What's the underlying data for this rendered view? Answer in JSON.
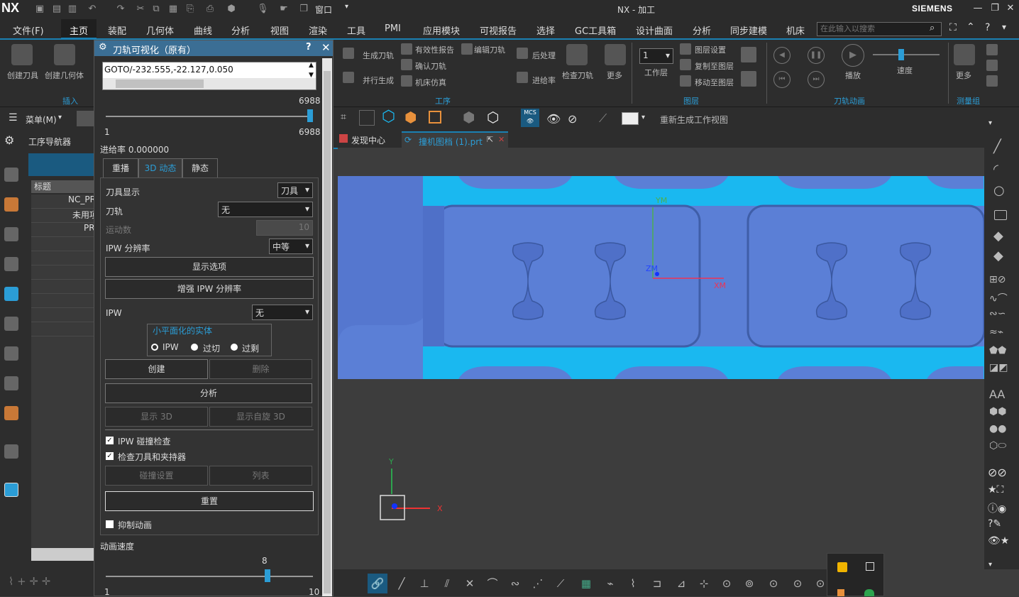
{
  "titlebar": {
    "logo": "NX",
    "window_menu": "窗口",
    "title": "NX - 加工",
    "brand": "SIEMENS"
  },
  "menubar": {
    "items": [
      "文件(F)",
      "主页",
      "装配",
      "几何体",
      "曲线",
      "分析",
      "视图",
      "渲染",
      "工具",
      "PMI",
      "应用模块",
      "可视报告",
      "选择",
      "GC工具箱",
      "设计曲面",
      "分析",
      "同步建模",
      "机床"
    ],
    "search_placeholder": "在此输入以搜索"
  },
  "ribbon": {
    "insert": {
      "create_tool": "创建刀具",
      "create_geometry": "创建几何体",
      "group": "插入"
    },
    "operation": {
      "gen_toolpath": "生成刀轨",
      "parallel_gen": "并行生成",
      "validity_report": "有效性报告",
      "confirm_toolpath": "确认刀轨",
      "machine_sim": "机床仿真",
      "edit_toolpath": "编辑刀轨",
      "postprocess": "后处理",
      "feedrate": "进给率",
      "check_toolpath": "检查刀轨",
      "more": "更多",
      "group": "工序"
    },
    "layer": {
      "work_layer_value": "1",
      "work_layer": "工作层",
      "layer_settings": "图层设置",
      "copy_to_layer": "复制至图层",
      "move_to_layer": "移动至图层",
      "group": "图层"
    },
    "animation": {
      "play": "播放",
      "speed": "速度",
      "group": "刀轨动画"
    },
    "measure": {
      "more": "更多",
      "group": "测量组"
    }
  },
  "toolbar2": {
    "menu": "菜单(M)",
    "regenerate": "重新生成工作视图",
    "mcs": "MCS"
  },
  "navigator": {
    "title": "工序导航器",
    "column": "标题",
    "rows": [
      "NC_PR",
      "未用项",
      "PR",
      "",
      "",
      "",
      "",
      "",
      "",
      ""
    ]
  },
  "dialog": {
    "title": "刀轨可视化（原有）",
    "goto_text": "GOTO/-232.555,-22.127,0.050",
    "slider_max_top": "6988",
    "slider_min": "1",
    "slider_max": "6988",
    "feedrate_label": "进给率",
    "feedrate_value": "0.000000",
    "tabs": [
      "重播",
      "3D 动态",
      "静态"
    ],
    "tool_display_label": "刀具显示",
    "tool_display_value": "刀具",
    "toolpath_label": "刀轨",
    "toolpath_value": "无",
    "motion_count_label": "运动数",
    "motion_count_value": "10",
    "ipw_res_label": "IPW 分辨率",
    "ipw_res_value": "中等",
    "display_options": "显示选项",
    "increase_ipw": "增强 IPW 分辨率",
    "ipw_label": "IPW",
    "ipw_value": "无",
    "faceted_group": "小平面化的实体",
    "radio_ipw": "IPW",
    "radio_overcut": "过切",
    "radio_excess": "过剩",
    "create": "创建",
    "delete": "删除",
    "analyze": "分析",
    "show_3d": "显示 3D",
    "show_self_3d": "显示自旋 3D",
    "chk_ipw_collision": "IPW 碰撞检查",
    "chk_tool_holder": "检查刀具和夹持器",
    "collision_settings": "碰撞设置",
    "list": "列表",
    "reset": "重置",
    "suppress_anim": "抑制动画",
    "anim_speed_label": "动画速度",
    "anim_speed_value": "8",
    "anim_min": "1",
    "anim_max": "10",
    "anim_speed_fraction": 0.78
  },
  "tabs": {
    "discover": "发现中心",
    "part": "撞机图档 (1).prt"
  },
  "viewport": {
    "ym": "YM",
    "xm": "XM",
    "zm": "ZM",
    "y": "Y",
    "x": "X"
  },
  "colors": {
    "accent": "#1a80b3",
    "part_blue": "#5b7fd6",
    "part_cyan": "#1ab8f0"
  }
}
